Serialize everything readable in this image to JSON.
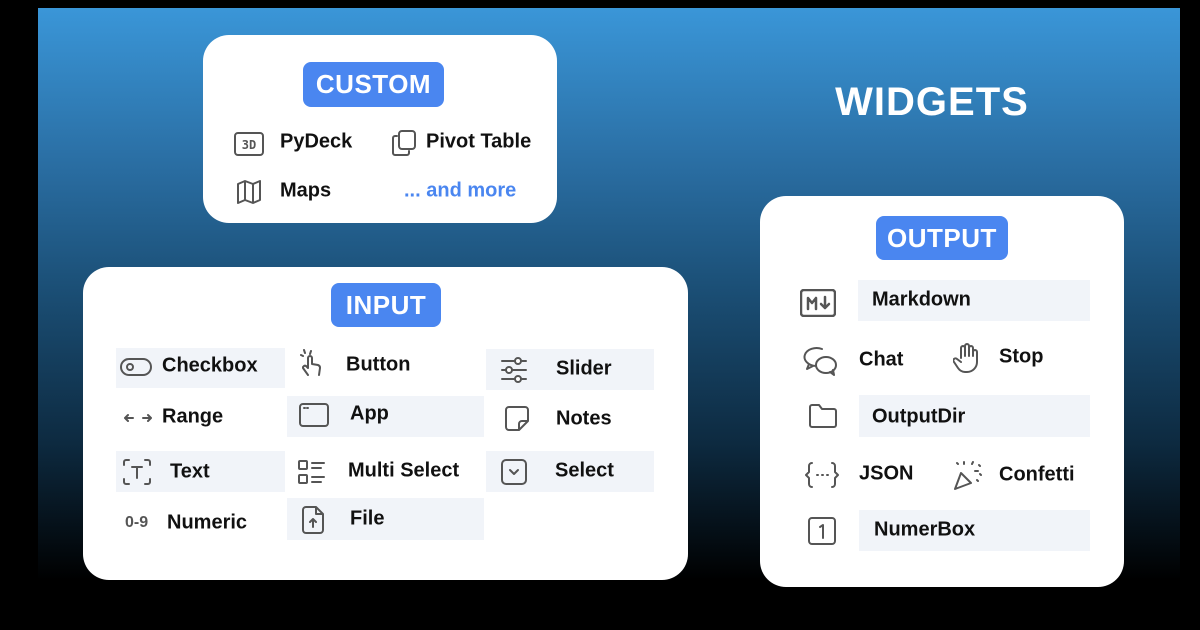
{
  "title": "WIDGETS",
  "colors": {
    "accent": "#4a86f0",
    "row_bg": "#f1f4f9",
    "link": "#4a86f0"
  },
  "custom": {
    "badge": "CUSTOM",
    "items": [
      {
        "label": "PyDeck",
        "icon": "3d-icon"
      },
      {
        "label": "Pivot Table",
        "icon": "copy-icon"
      },
      {
        "label": "Maps",
        "icon": "map-icon"
      },
      {
        "label": "... and more"
      }
    ]
  },
  "input": {
    "badge": "INPUT",
    "items": [
      {
        "label": "Checkbox",
        "icon": "toggle-icon"
      },
      {
        "label": "Button",
        "icon": "hand-click-icon"
      },
      {
        "label": "Slider",
        "icon": "sliders-icon"
      },
      {
        "label": "Range",
        "icon": "arrows-horizontal-icon"
      },
      {
        "label": "App",
        "icon": "window-icon"
      },
      {
        "label": "Notes",
        "icon": "note-icon"
      },
      {
        "label": "Text",
        "icon": "text-box-icon"
      },
      {
        "label": "Multi Select",
        "icon": "list-icon"
      },
      {
        "label": "Select",
        "icon": "select-icon"
      },
      {
        "label": "Numeric",
        "icon": "0-9"
      },
      {
        "label": "File",
        "icon": "file-upload-icon"
      }
    ]
  },
  "output": {
    "badge": "OUTPUT",
    "items": [
      {
        "label": "Markdown",
        "icon": "markdown-icon"
      },
      {
        "label": "Chat",
        "icon": "chat-icon"
      },
      {
        "label": "Stop",
        "icon": "hand-stop-icon"
      },
      {
        "label": "OutputDir",
        "icon": "folder-icon"
      },
      {
        "label": "JSON",
        "icon": "braces-icon"
      },
      {
        "label": "Confetti",
        "icon": "confetti-icon"
      },
      {
        "label": "NumerBox",
        "icon": "number-box-icon"
      }
    ]
  }
}
